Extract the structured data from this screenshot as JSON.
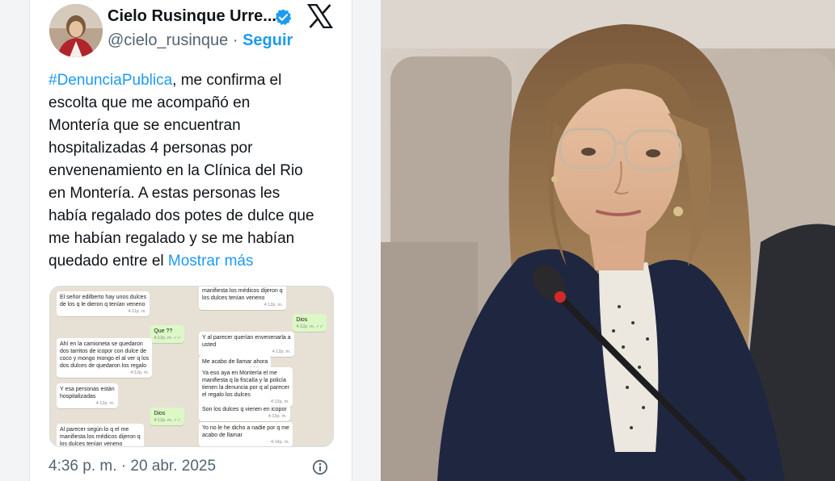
{
  "tweet": {
    "author_name": "Cielo Rusinque Urre...",
    "handle": "@cielo_rusinque",
    "separator": " · ",
    "follow_label": "Seguir",
    "text_lines": [
      "me confirma el",
      "escolta que me acompañó en",
      "Montería que se encuentran",
      "hospitalizadas 4 personas por",
      "envenenamiento en la Clínica del Rio",
      "en Montería. A estas personas les",
      "había regalado dos potes de dulce que",
      "me habían regalado y se me habían",
      "quedado entre el"
    ],
    "hashtag": "#DenunciaPublica",
    "hashtag_suffix": ",",
    "show_more_label": "Mostrar más",
    "time": "4:36 p. m.",
    "date": "20 abr. 2025",
    "meta_separator": " · ",
    "icons": {
      "verified": "verified-badge-icon",
      "brand": "x-logo-icon",
      "info": "info-icon"
    },
    "colors": {
      "accent": "#1d9bf0",
      "text": "#0f1419",
      "secondary": "#536471"
    }
  },
  "chat": {
    "left_column": [
      {
        "dir": "in",
        "text": "El señor edilberto hay unos dulces\nde los q le dieron q tenían veneno",
        "time": "4:11p. m."
      },
      {
        "dir": "out",
        "text": "Que ??",
        "time": "4:12p. m. ✓✓"
      },
      {
        "dir": "in",
        "text": "Ahí en la camioneta se quedaron\ndos tarritos de icopor con dulce de\ncoco y mongo mongo el al ver q los\ndos dulces de quedaron los regalo",
        "time": "4:12p. m."
      },
      {
        "dir": "in",
        "text": "Y esa personas están\nhospitalizadas",
        "time": "4:12p. m."
      },
      {
        "dir": "out",
        "text": "Dios",
        "time": "4:12p. m. ✓✓"
      },
      {
        "dir": "in",
        "text": "Al parecer según lo q el me\nmanifiesta los médicos dijeron q\nlos dulces tenían veneno",
        "time": ""
      }
    ],
    "right_column": [
      {
        "dir": "in",
        "text": "manifiesta los médicos dijeron q\nlos dulces tenían veneno",
        "time": "4:12p. m."
      },
      {
        "dir": "out",
        "text": "Dios",
        "time": "4:12p. m. ✓✓"
      },
      {
        "dir": "in",
        "text": "Y al parecer querían envenenarla a\nusted",
        "time": "4:12p. m."
      },
      {
        "dir": "in",
        "text": "Me acabo de llamar ahora",
        "time": "4:13p. m."
      },
      {
        "dir": "in",
        "text": "Ya eso aya en Montería el me\nmanifiesta q la fiscalía y la policía\ntienen la denuncia por q al parecer\nel regalo los dulces",
        "time": "4:13p. m."
      },
      {
        "dir": "in",
        "text": "Son los dulces q vienen en icopor",
        "time": "4:13p. m."
      },
      {
        "dir": "in",
        "text": "Yo no le he dicho a nadie por q me\nacabo de llamar",
        "time": "4:14p. m."
      }
    ]
  }
}
